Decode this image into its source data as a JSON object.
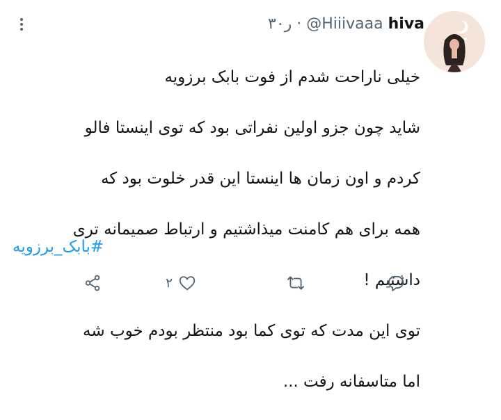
{
  "tweet": {
    "display_name": "hiva",
    "handle": "@Hiiivaaa",
    "separator": "·",
    "time": "۳۰ر",
    "text_lines": [
      "خیلی ناراحت شدم از فوت بابک برزویه",
      "شاید چون جزو اولین نفراتی بود که توی اینستا فالو",
      "کردم و اون زمان ها اینستا این قدر خلوت بود که",
      "همه برای هم کامنت میذاشتیم و ارتباط صمیمانه تری",
      "داشتیم !",
      "توی این مدت که توی کما بود منتظر بودم خوب شه",
      "اما متاسفانه رفت ..."
    ],
    "hashtag": "#بابک_برزویه",
    "like_count": "۲"
  },
  "icons": {
    "more": "more-icon",
    "share": "share-icon",
    "like": "heart-icon",
    "retweet": "retweet-icon",
    "reply": "reply-icon"
  },
  "colors": {
    "text": "#0f1419",
    "secondary": "#536471",
    "link": "#1d9bf0",
    "background": "#ffffff"
  }
}
